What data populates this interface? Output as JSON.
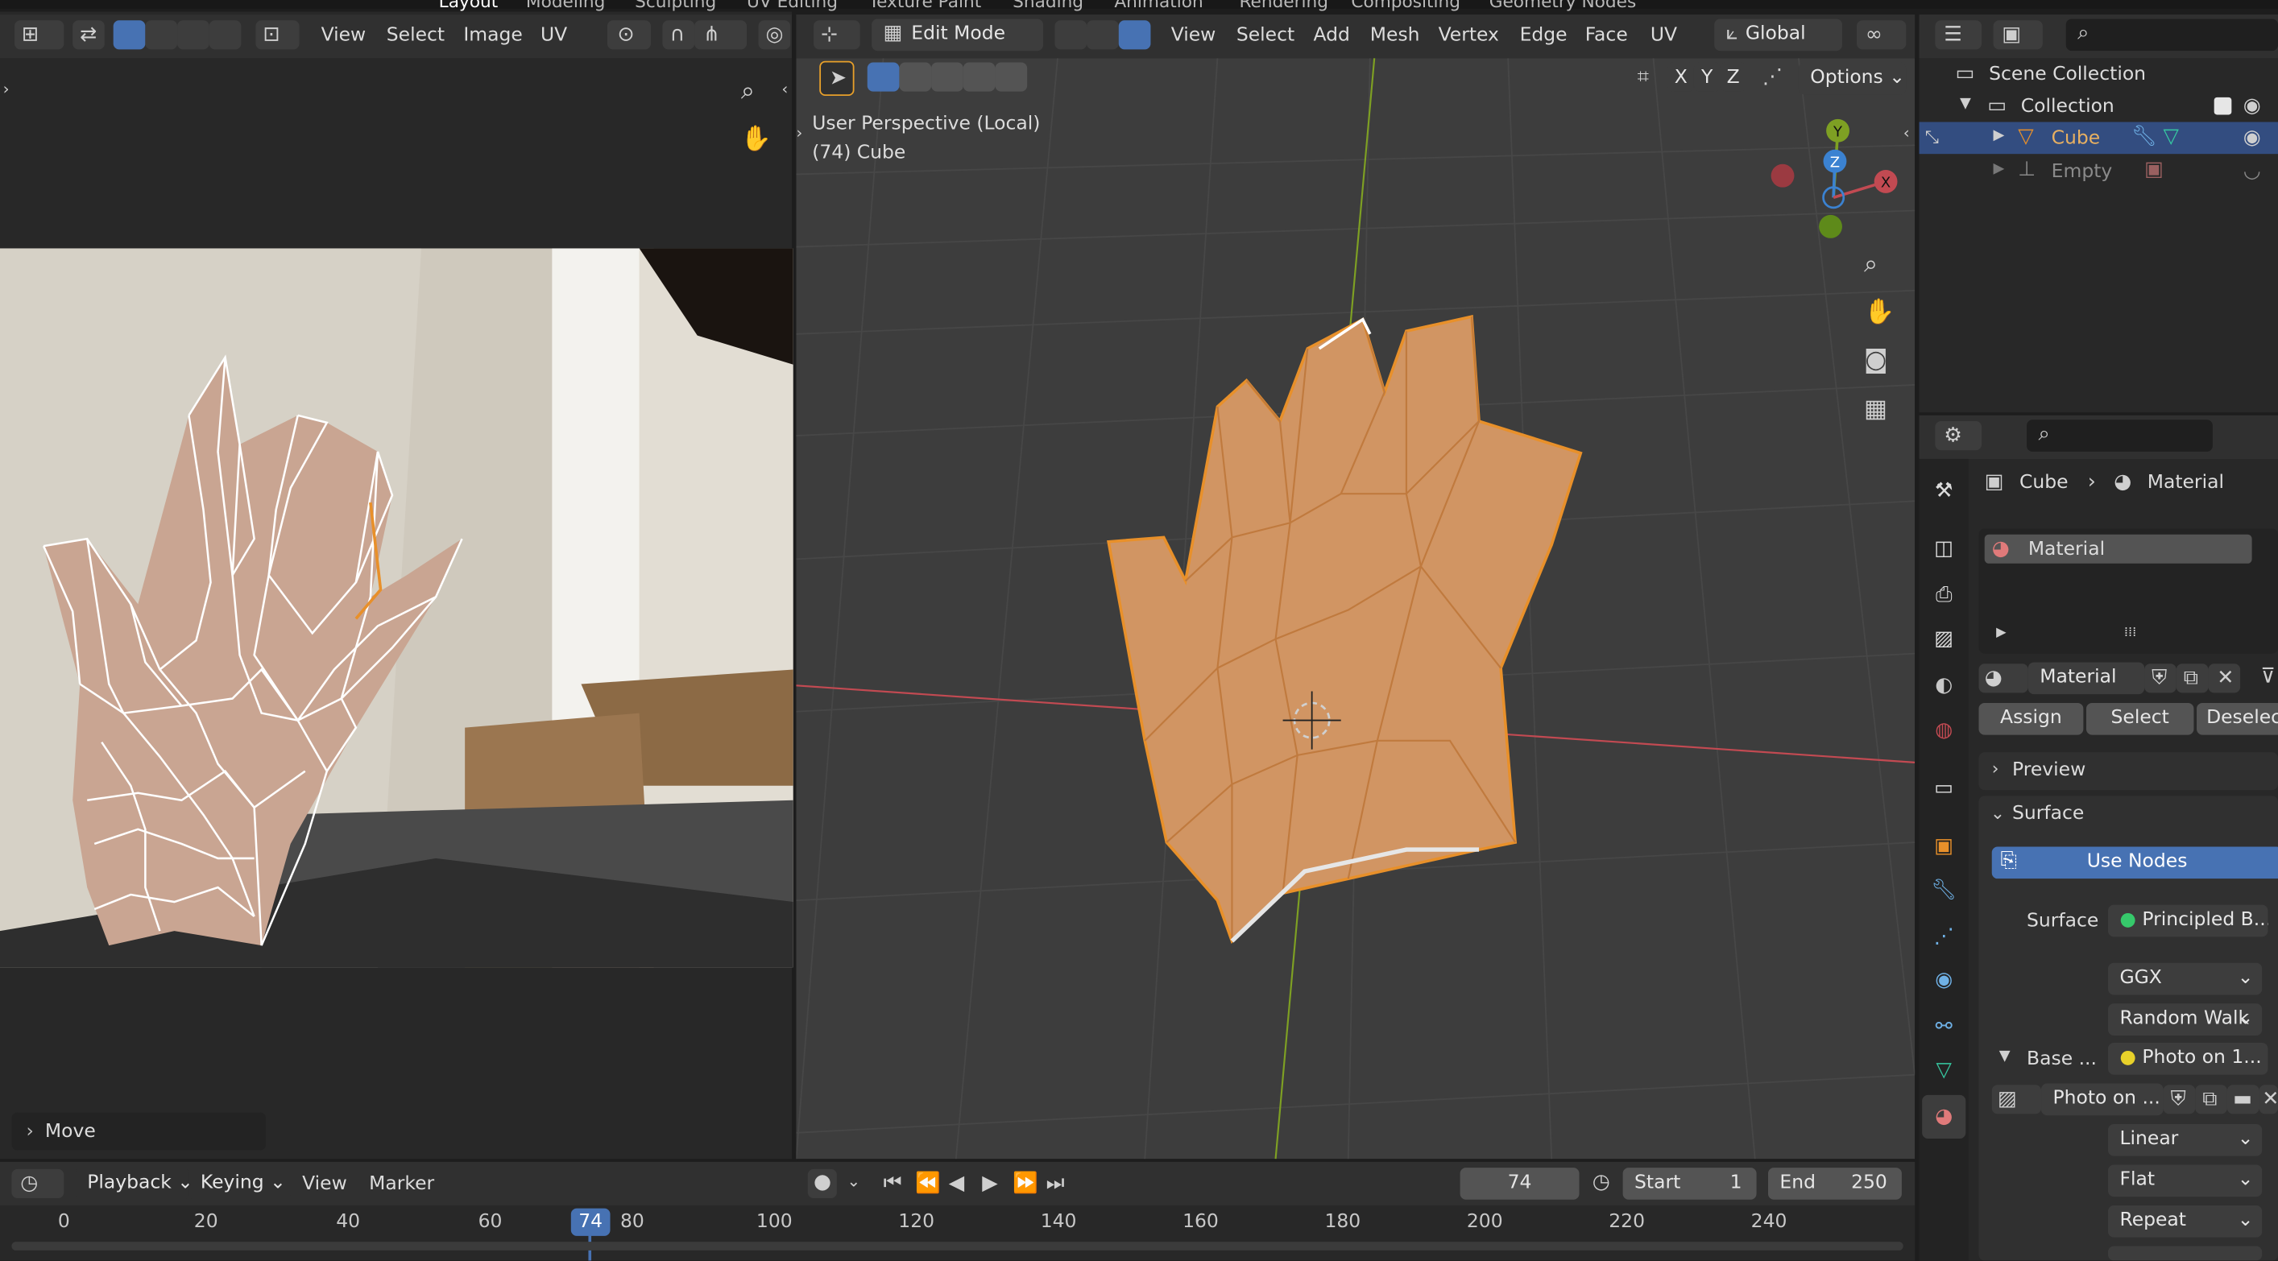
{
  "workspace_tabs": [
    "Layout",
    "Modeling",
    "Sculpting",
    "UV Editing",
    "Texture Paint",
    "Shading",
    "Animation",
    "Rendering",
    "Compositing",
    "Geometry Nodes"
  ],
  "image_editor": {
    "menus": [
      "View",
      "Select",
      "Image",
      "UV"
    ],
    "operator_panel": "Move"
  },
  "viewport": {
    "mode": "Edit Mode",
    "menus": [
      "View",
      "Select",
      "Add",
      "Mesh",
      "Vertex",
      "Edge",
      "Face",
      "UV"
    ],
    "orientation": "Global",
    "axis_x": "X",
    "axis_y": "Y",
    "axis_z": "Z",
    "options": "Options",
    "overlay_line1": "User Perspective (Local)",
    "overlay_line2": "(74) Cube",
    "gizmo_x": "X",
    "gizmo_y": "Y",
    "gizmo_z": "Z"
  },
  "outliner": {
    "scene_collection": "Scene Collection",
    "collection": "Collection",
    "items": [
      "Cube",
      "Empty"
    ]
  },
  "properties": {
    "breadcrumb_object": "Cube",
    "breadcrumb_material": "Material",
    "slot": "Material",
    "material_name": "Material",
    "assign": "Assign",
    "select": "Select",
    "deselect": "Deselect",
    "preview": "Preview",
    "surface_section": "Surface",
    "use_nodes": "Use Nodes",
    "surface_label": "Surface",
    "surface_value": "Principled B...",
    "distribution": "GGX",
    "subsurface": "Random Walk",
    "base_label": "Base ...",
    "base_value": "Photo on 1...",
    "image_name": "Photo on ...",
    "interpolation": "Linear",
    "projection": "Flat",
    "extension": "Repeat"
  },
  "timeline": {
    "menus": [
      "Playback",
      "Keying",
      "View",
      "Marker"
    ],
    "current_frame": "74",
    "start_label": "Start",
    "start_value": "1",
    "end_label": "End",
    "end_value": "250",
    "ruler": [
      "0",
      "20",
      "40",
      "60",
      "80",
      "100",
      "120",
      "140",
      "160",
      "180",
      "200",
      "220",
      "240"
    ]
  },
  "colors": {
    "accent": "#4772b3",
    "selection_orange": "#e8902a",
    "x_axis": "#c24a52",
    "y_axis": "#7ea023"
  }
}
